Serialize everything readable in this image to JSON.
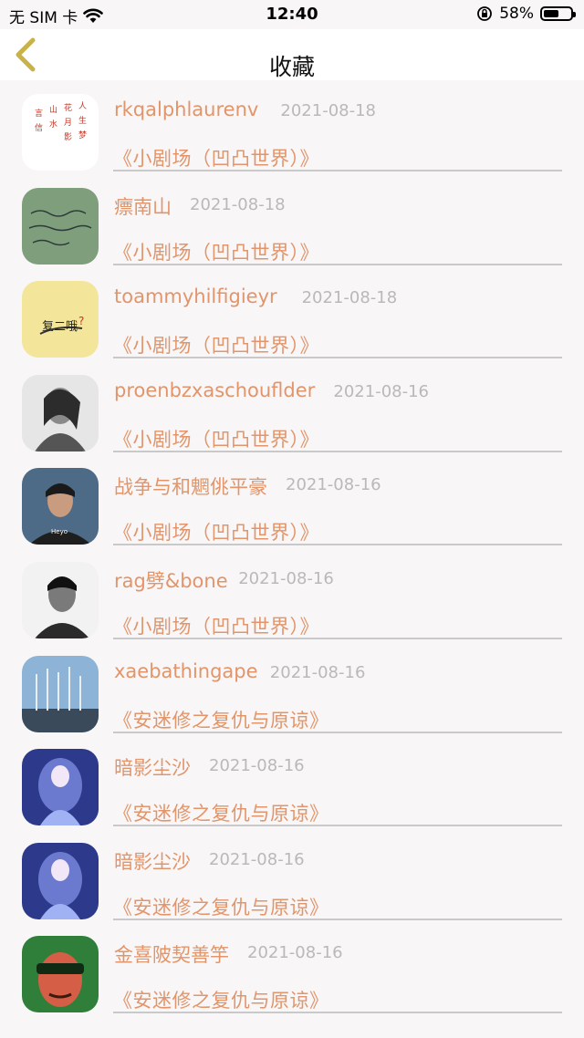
{
  "status_bar": {
    "carrier": "无 SIM 卡",
    "time": "12:40",
    "battery_text": "58%",
    "battery_level": 0.58
  },
  "nav": {
    "title": "收藏",
    "back_icon": "chevron-left-icon"
  },
  "colors": {
    "accent": "#e2956a",
    "date": "#b9b9b9",
    "back_chevron": "#c7b34a",
    "background": "#f8f6f7"
  },
  "favorites": [
    {
      "user": "rkqalphlaurenv",
      "date": "2021-08-18",
      "work": "《小剧场（凹凸世界）》"
    },
    {
      "user": "瘭南山",
      "date": "2021-08-18",
      "work": "《小剧场（凹凸世界）》"
    },
    {
      "user": "toammyhilfigieyr",
      "date": "2021-08-18",
      "work": "《小剧场（凹凸世界）》"
    },
    {
      "user": "proenbzxaschouflder",
      "date": "2021-08-16",
      "work": "《小剧场（凹凸世界）》"
    },
    {
      "user": "战争与和魍佻平豪",
      "date": "2021-08-16",
      "work": "《小剧场（凹凸世界）》"
    },
    {
      "user": "rag劈&bone",
      "date": "2021-08-16",
      "work": "《小剧场（凹凸世界）》"
    },
    {
      "user": "xaebathingape",
      "date": "2021-08-16",
      "work": "《安迷修之复仇与原谅》"
    },
    {
      "user": "暗影尘沙",
      "date": "2021-08-16",
      "work": "《安迷修之复仇与原谅》"
    },
    {
      "user": "暗影尘沙",
      "date": "2021-08-16",
      "work": "《安迷修之复仇与原谅》"
    },
    {
      "user": "金喜陂契善竽",
      "date": "2021-08-16",
      "work": "《安迷修之复仇与原谅》"
    }
  ]
}
